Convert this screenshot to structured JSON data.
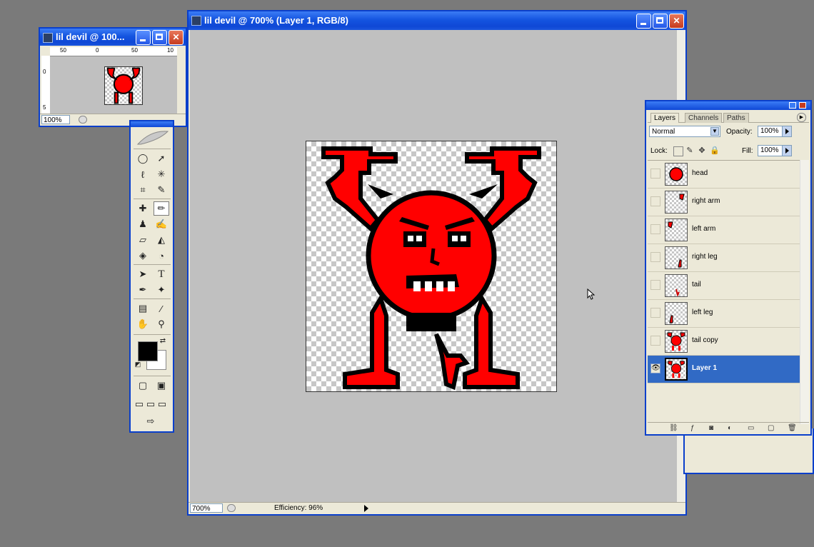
{
  "doc_window": {
    "title": "lil devil @ 700% (Layer 1, RGB/8)",
    "zoom": "700%",
    "efficiency": "Efficiency: 96%"
  },
  "nav_window": {
    "title": "lil devil @ 100...",
    "zoom": "100%",
    "ruler_h": [
      "50",
      "0",
      "50",
      "10"
    ],
    "ruler_v": [
      "0",
      "5"
    ]
  },
  "layers_panel": {
    "tabs": [
      "Layers",
      "Channels",
      "Paths"
    ],
    "blend_mode": "Normal",
    "opacity_label": "Opacity:",
    "opacity_value": "100%",
    "lock_label": "Lock:",
    "fill_label": "Fill:",
    "fill_value": "100%",
    "layers": [
      {
        "name": "head",
        "visible": false,
        "selected": false
      },
      {
        "name": "right arm",
        "visible": false,
        "selected": false
      },
      {
        "name": "left arm",
        "visible": false,
        "selected": false
      },
      {
        "name": "right leg",
        "visible": false,
        "selected": false
      },
      {
        "name": "tail",
        "visible": false,
        "selected": false
      },
      {
        "name": "left leg",
        "visible": false,
        "selected": false
      },
      {
        "name": "tail copy",
        "visible": false,
        "selected": false
      },
      {
        "name": "Layer 1",
        "visible": true,
        "selected": true
      }
    ]
  },
  "colors": {
    "accent": "#0a3fcb",
    "selection": "#316ac5",
    "devil_red": "#ff0000",
    "foreground": "#000000",
    "background": "#ffffff"
  }
}
